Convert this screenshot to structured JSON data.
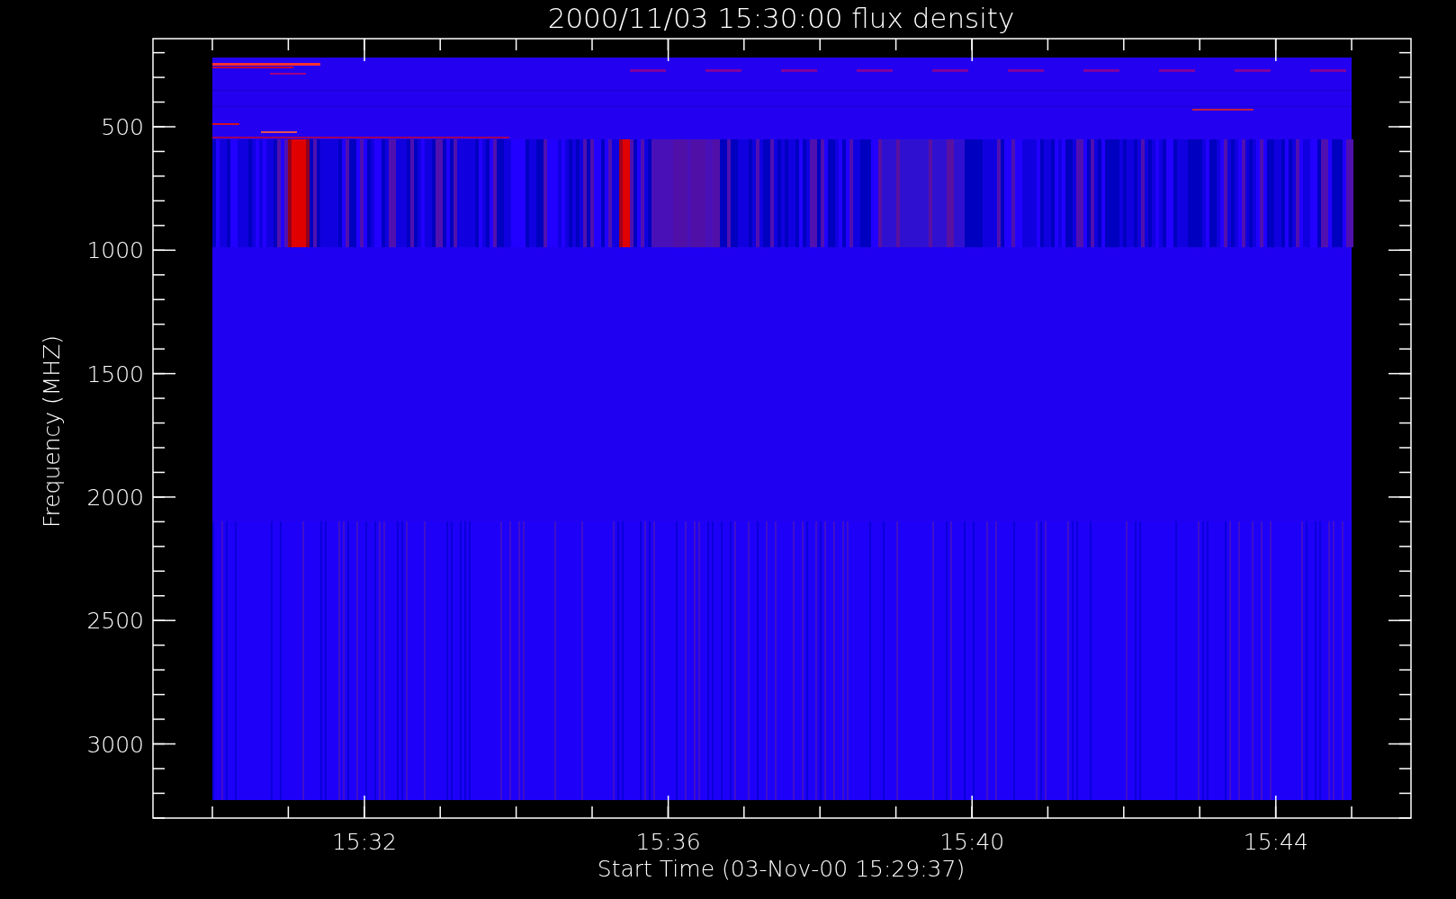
{
  "plot": {
    "title": "2000/11/03 15:30:00 flux density",
    "y_axis": {
      "label": "Frequency (MHZ)",
      "ticks": [
        "500",
        "1000",
        "1500",
        "2000",
        "2500",
        "3000"
      ]
    },
    "x_axis": {
      "label": "Start Time (03-Nov-00 15:29:37)",
      "ticks": [
        "15:32",
        "15:36",
        "15:40",
        "15:44"
      ]
    }
  }
}
